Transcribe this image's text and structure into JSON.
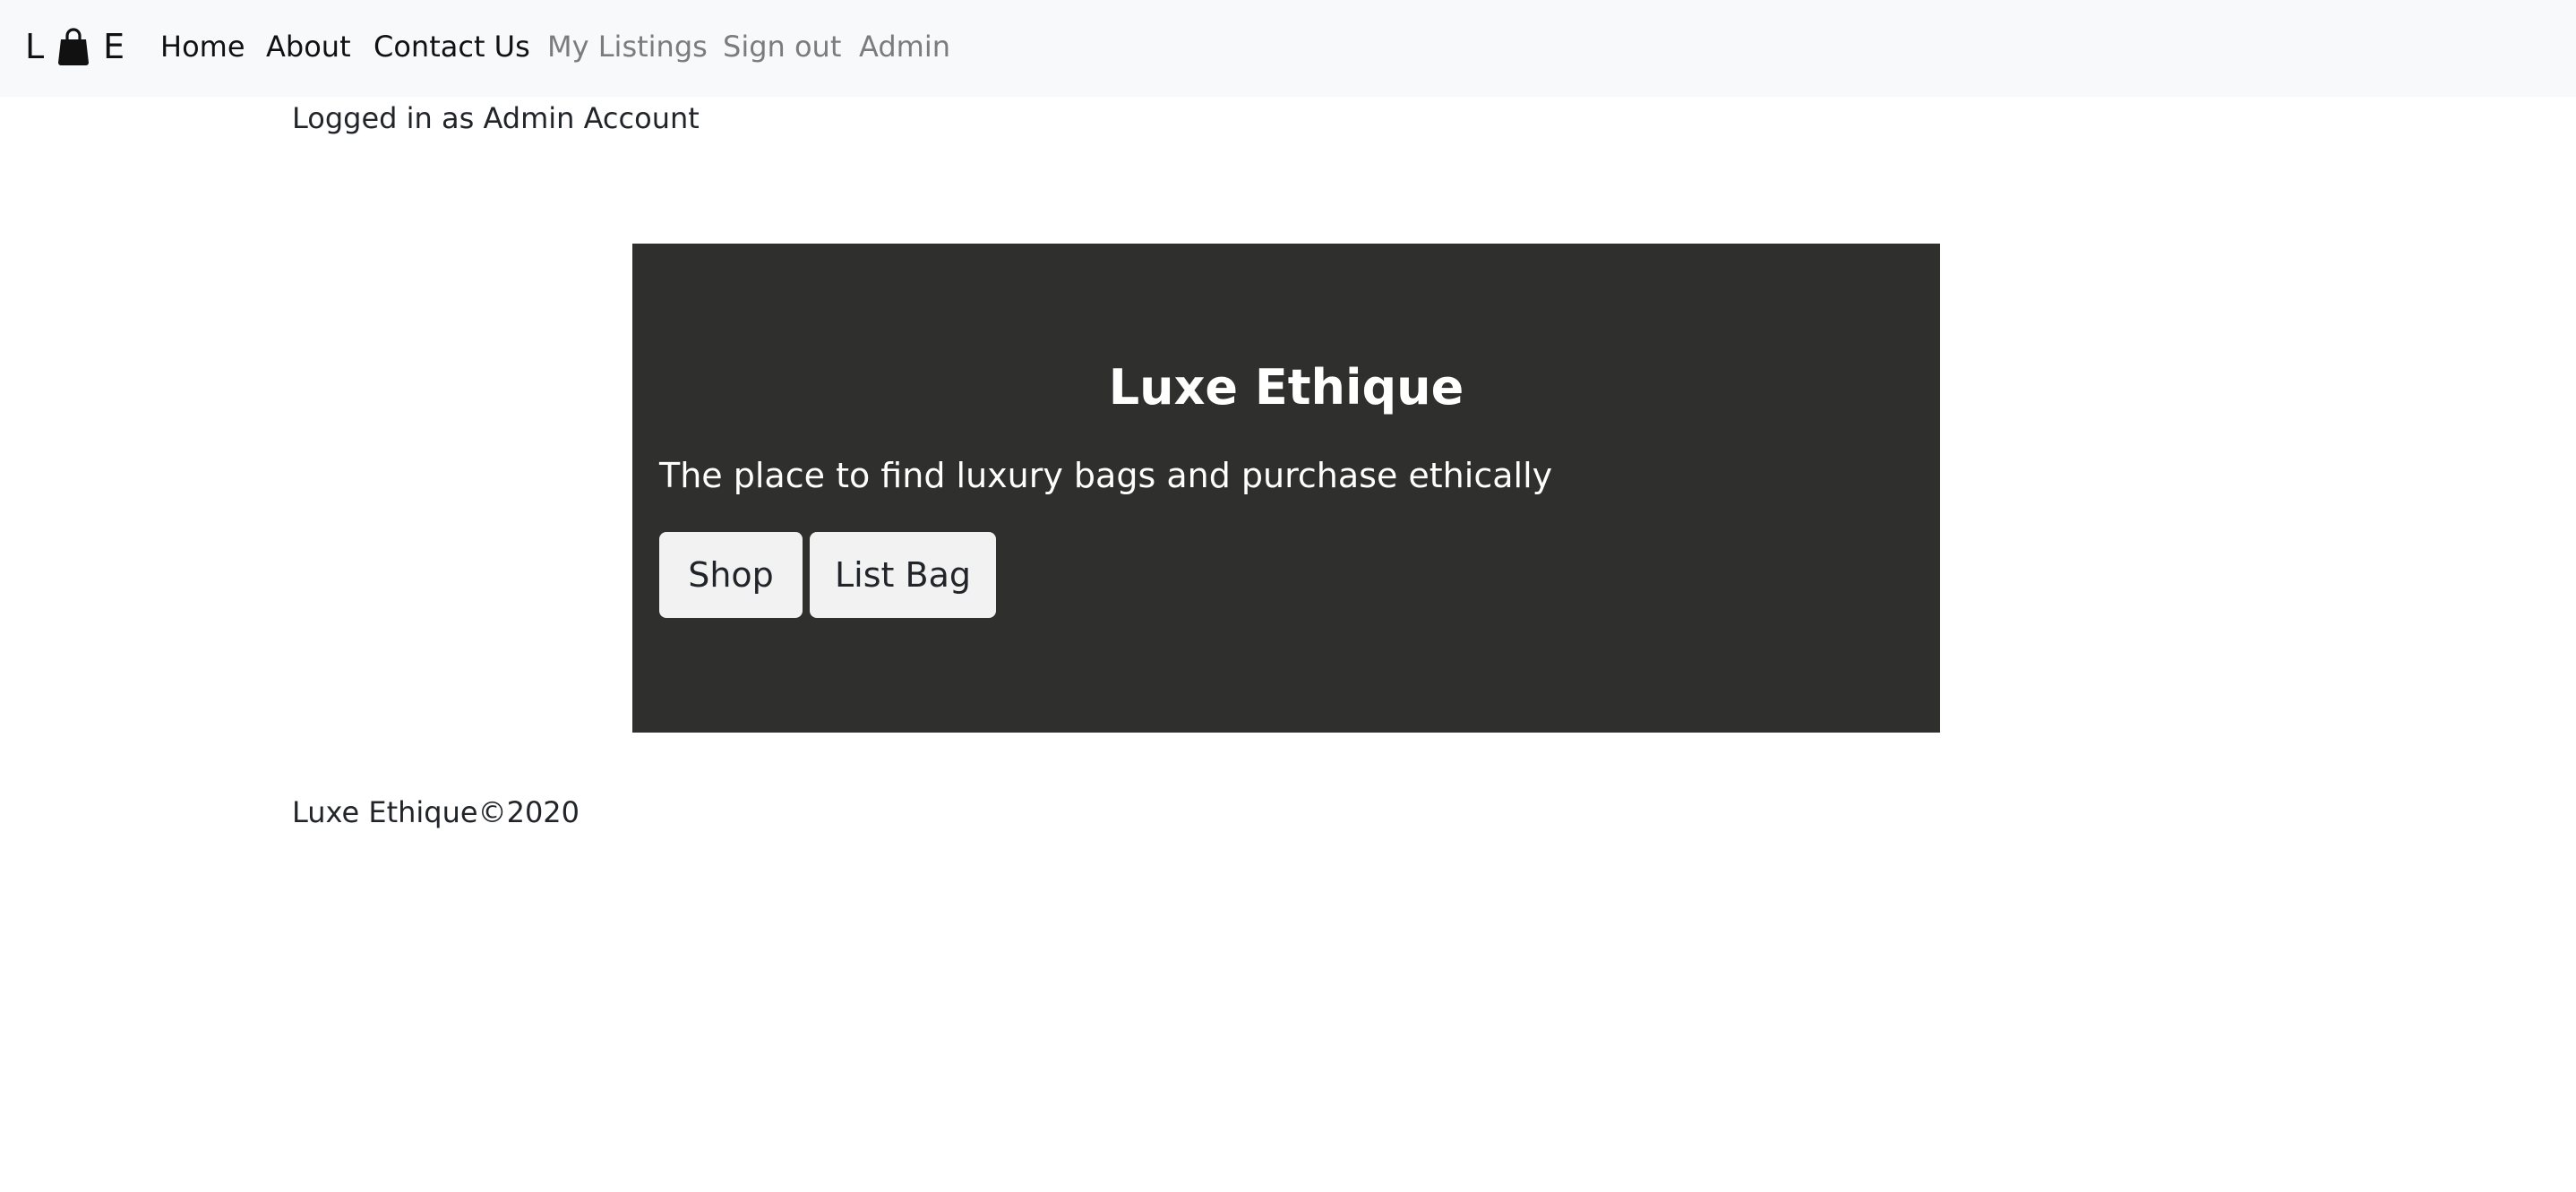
{
  "navbar": {
    "brand": {
      "left": "L",
      "right": "E",
      "icon": "handbag-icon"
    },
    "links": {
      "home": "Home",
      "about": "About",
      "contact": "Contact Us",
      "my_listings": "My Listings",
      "sign_out": "Sign out",
      "admin": "Admin"
    }
  },
  "status": {
    "logged_in": "Logged in as Admin Account"
  },
  "hero": {
    "title": "Luxe Ethique",
    "tagline": "The place to find luxury bags and purchase ethically",
    "shop_label": "Shop",
    "list_bag_label": "List Bag"
  },
  "footer": {
    "text": "Luxe Ethique©2020"
  },
  "colors": {
    "navbar_bg": "#f8f9fa",
    "hero_bg": "#2f2f2d",
    "button_bg": "#f2f2f2",
    "muted_link": "#7a7d80"
  }
}
